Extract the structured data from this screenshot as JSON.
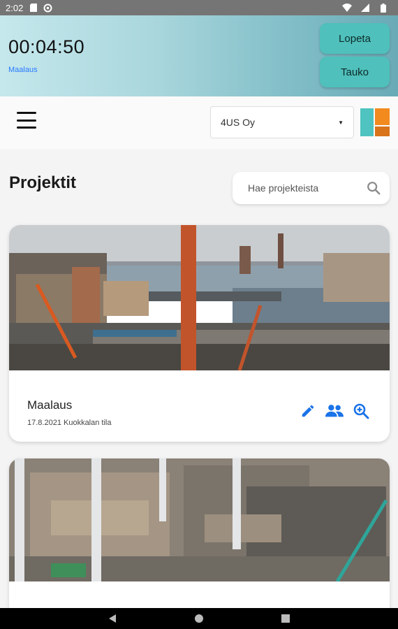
{
  "status_bar": {
    "time": "2:02"
  },
  "timer": {
    "elapsed": "00:04:50",
    "task": "Maalaus",
    "stop_label": "Lopeta",
    "pause_label": "Tauko"
  },
  "header": {
    "company": "4US Oy"
  },
  "page": {
    "title": "Projektit",
    "search_placeholder": "Hae projekteista"
  },
  "projects": [
    {
      "name": "Maalaus",
      "meta": "17.8.2021 Kuokkalan tila"
    }
  ],
  "colors": {
    "accent": "#4fc0bb",
    "action_blue": "#1a73e8",
    "link_blue": "#2979ff",
    "logo_teal": "#4fc3bf",
    "logo_orange": "#f28a1e"
  },
  "icons": {
    "edit": "pencil-icon",
    "members": "people-icon",
    "details": "zoom-in-icon",
    "search": "search-icon"
  }
}
